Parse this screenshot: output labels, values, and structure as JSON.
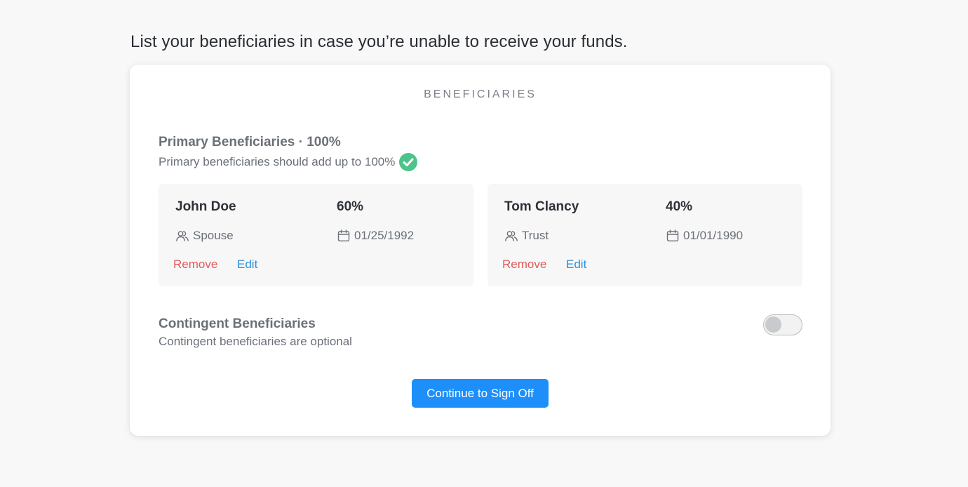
{
  "heading": "List your beneficiaries in case you’re unable to receive your funds.",
  "card": {
    "title": "BENEFICIARIES",
    "primary": {
      "title": "Primary Beneficiaries · 100%",
      "subtitle": "Primary beneficiaries should add up to 100%",
      "status_icon": "check-circle-icon",
      "beneficiaries": [
        {
          "name": "John Doe",
          "percent": "60%",
          "relationship": "Spouse",
          "dob": "01/25/1992",
          "remove_label": "Remove",
          "edit_label": "Edit"
        },
        {
          "name": "Tom Clancy",
          "percent": "40%",
          "relationship": "Trust",
          "dob": "01/01/1990",
          "remove_label": "Remove",
          "edit_label": "Edit"
        }
      ]
    },
    "contingent": {
      "title": "Contingent Beneficiaries",
      "subtitle": "Contingent beneficiaries are optional",
      "enabled": false
    },
    "continue_label": "Continue to Sign Off"
  },
  "colors": {
    "accent": "#1e8ffa",
    "remove": "#e05a5a",
    "edit": "#2a8fd8",
    "success": "#4cc38a"
  }
}
